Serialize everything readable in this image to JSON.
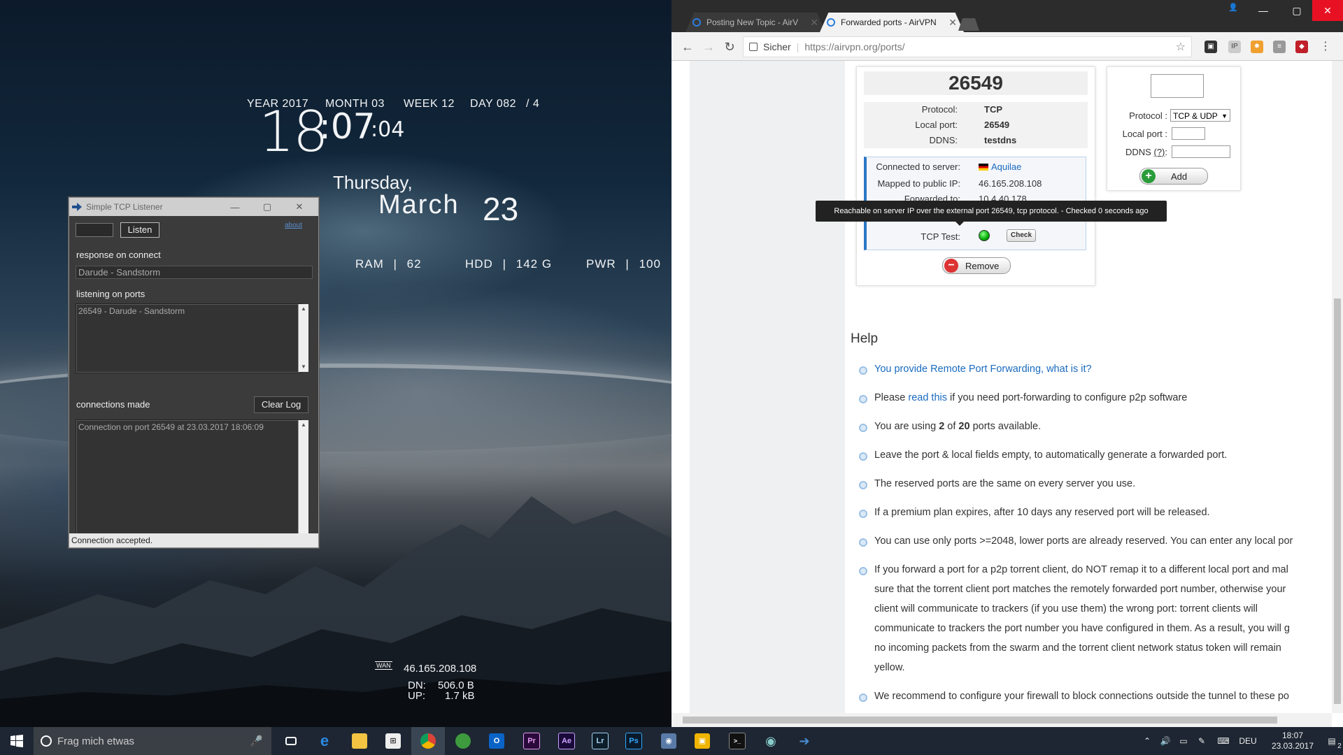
{
  "desktop": {
    "date_widget": {
      "year": "YEAR 2017",
      "month": "MONTH 03",
      "week": "WEEK 12",
      "day": "DAY 082",
      "day_suffix": "/ 4",
      "hour": "18",
      "minute": ":07",
      "second": ":04",
      "weekday": "Thursday,",
      "month_name": "March",
      "day_num": "23"
    },
    "stats": {
      "ram_label": "RAM",
      "ram_value": "62",
      "hdd_label": "HDD",
      "hdd_value": "142 G",
      "pwr_label": "PWR",
      "pwr_value": "100",
      "sep": "|"
    },
    "network": {
      "wan_label": "WAN",
      "ip": "46.165.208.108",
      "dn_label": "DN:",
      "dn_value": "506.0 B",
      "up_label": "UP:",
      "up_value": "1.7 kB"
    }
  },
  "tcp_window": {
    "title": "Simple TCP Listener",
    "listen_label": "Listen",
    "about_label": "about",
    "port_input_value": "",
    "response_label": "response on connect",
    "response_value": "Darude - Sandstorm",
    "ports_label": "listening on ports",
    "ports_list": [
      "26549 - Darude - Sandstorm"
    ],
    "connections_label": "connections made",
    "clear_log_label": "Clear Log",
    "connections_log": [
      "Connection on port 26549 at 23.03.2017 18:06:09"
    ],
    "status": "Connection accepted."
  },
  "browser": {
    "tabs": [
      {
        "label": "Posting New Topic - AirV",
        "active": false
      },
      {
        "label": "Forwarded ports - AirVPN",
        "active": true
      }
    ],
    "omnibox": {
      "secure_label": "Sicher",
      "url": "https://airvpn.org/ports/"
    },
    "port_card": {
      "port": "26549",
      "protocol_label": "Protocol:",
      "protocol_value": "TCP",
      "local_port_label": "Local port:",
      "local_port_value": "26549",
      "ddns_label": "DDNS:",
      "ddns_value": "testdns",
      "server_label": "Connected to server:",
      "server_value": "Aquilae",
      "mapped_label": "Mapped to public IP:",
      "mapped_value": "46.165.208.108",
      "forwarded_label": "Forwarded to:",
      "forwarded_value": "10.4.40.178",
      "tcp_test_label": "TCP Test:",
      "check_label": "Check",
      "tooltip": "Reachable on server IP over the external port 26549, tcp protocol. - Checked 0 seconds ago",
      "remove_label": "Remove"
    },
    "add_card": {
      "protocol_label": "Protocol :",
      "protocol_value": "TCP & UDP",
      "local_port_label": "Local port :",
      "ddns_label": "DDNS",
      "ddns_help": "(?)",
      "ddns_colon": ":",
      "add_label": "Add"
    },
    "help": {
      "title": "Help",
      "items": {
        "i1_link": "You provide Remote Port Forwarding, what is it?",
        "i2_pre": "Please ",
        "i2_link": "read this",
        "i2_post": " if you need port-forwarding to configure p2p software",
        "i3_pre": "You are using ",
        "i3_used": "2",
        "i3_mid": " of ",
        "i3_total": "20",
        "i3_post": " ports available.",
        "i4": "Leave the port & local fields empty, to automatically generate a forwarded port.",
        "i5": "The reserved ports are the same on every server you use.",
        "i6": "If a premium plan expires, after 10 days any reserved port will be released.",
        "i7": "You can use only ports >=2048, lower ports are already reserved. You can enter any local por",
        "i8_l1": "If you forward a port for a p2p torrent client, do NOT remap it to a different local port and mal",
        "i8_l2": "sure that the torrent client port matches the remotely forwarded port number, otherwise your",
        "i8_l3": "client will communicate to trackers (if you use them) the wrong port: torrent clients will",
        "i8_l4": "communicate to trackers the port number you have configured in them. As a result, you will g",
        "i8_l5": "no incoming packets from the swarm and the torrent client network status token will remain",
        "i8_l6": "yellow.",
        "i9": "We recommend to configure your firewall to block connections outside the tunnel to these po"
      }
    }
  },
  "taskbar": {
    "search_placeholder": "Frag mich etwas",
    "language": "DEU",
    "time": "18:07",
    "date": "23.03.2017",
    "notification_count": "2"
  }
}
